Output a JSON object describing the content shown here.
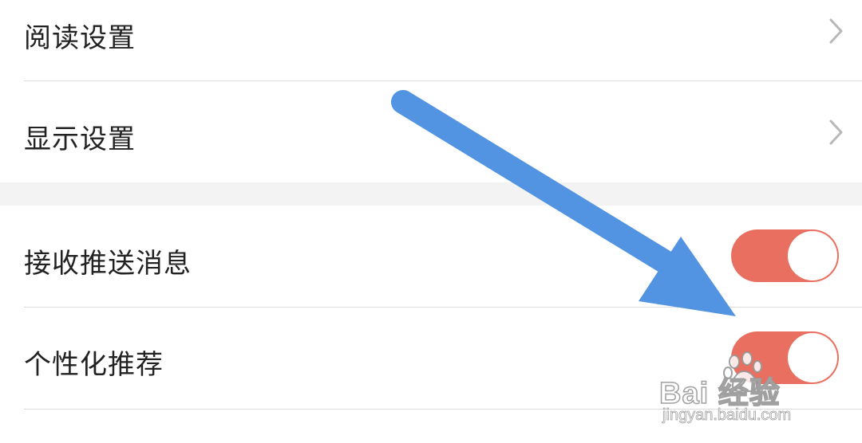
{
  "settings": {
    "group1": [
      {
        "label": "阅读设置",
        "control": "chevron-right-icon"
      },
      {
        "label": "显示设置",
        "control": "chevron-right-icon"
      }
    ],
    "group2": [
      {
        "label": "接收推送消息",
        "control": "toggle",
        "on": true
      },
      {
        "label": "个性化推荐",
        "control": "toggle",
        "on": true
      }
    ]
  },
  "colors": {
    "toggle_on": "#e96f60",
    "annotation_arrow": "#5294e2",
    "divider": "#dcdcdc",
    "section_gap": "#f3f3f3"
  },
  "watermark": {
    "brand": "Bai  经验",
    "url": "jingyan.baidu.com",
    "icon": "paw-icon"
  }
}
